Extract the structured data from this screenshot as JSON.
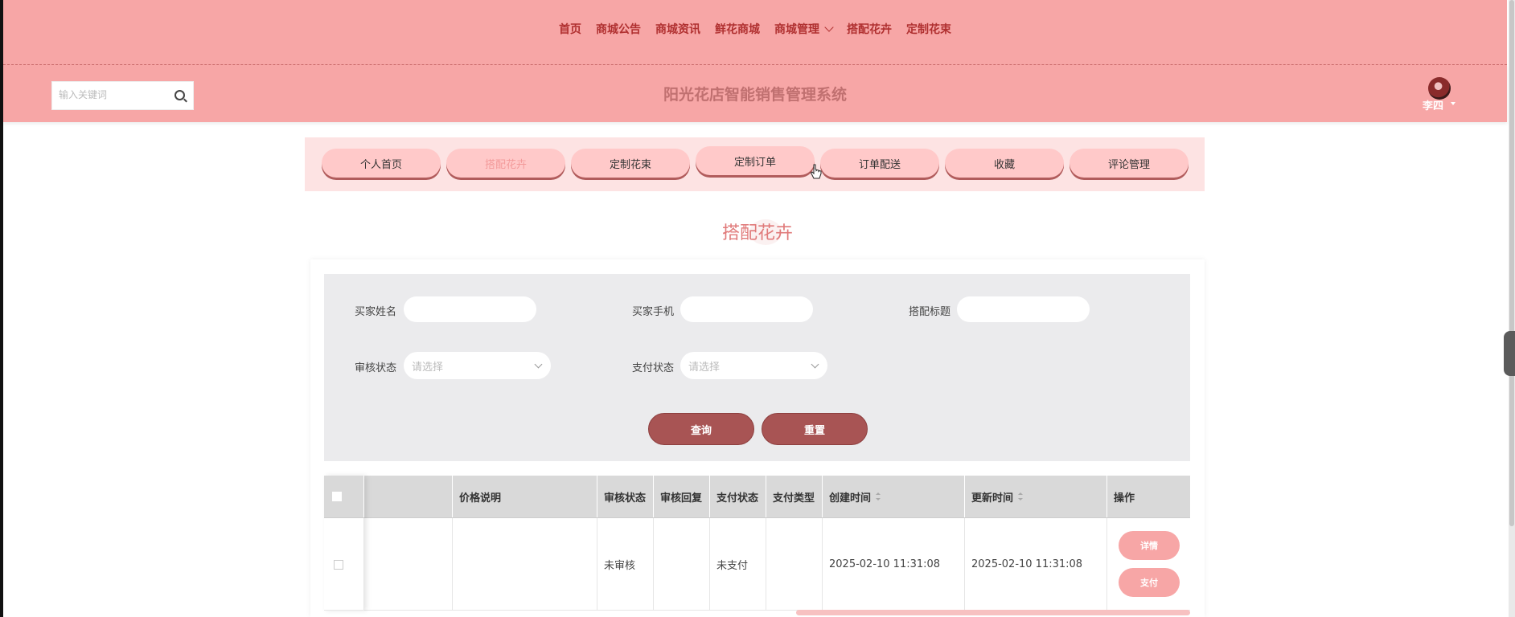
{
  "nav": {
    "items": [
      "首页",
      "商城公告",
      "商城资讯",
      "鲜花商城",
      "商城管理",
      "搭配花卉",
      "定制花束"
    ]
  },
  "header": {
    "search_placeholder": "输入关键词",
    "site_title": "阳光花店智能销售管理系统",
    "user_name": "李四"
  },
  "tabs": {
    "items": [
      "个人首页",
      "搭配花卉",
      "定制花束",
      "定制订单",
      "订单配送",
      "收藏",
      "评论管理"
    ],
    "active": "搭配花卉"
  },
  "page": {
    "title": "搭配花卉"
  },
  "filters": {
    "buyer_name_label": "买家姓名",
    "buyer_phone_label": "买家手机",
    "match_title_label": "搭配标题",
    "review_status_label": "审核状态",
    "review_status_placeholder": "请选择",
    "pay_status_label": "支付状态",
    "pay_status_placeholder": "请选择",
    "query_button": "查询",
    "reset_button": "重置"
  },
  "table": {
    "columns": [
      "价格说明",
      "审核状态",
      "审核回复",
      "支付状态",
      "支付类型",
      "创建时间",
      "更新时间",
      "操作"
    ],
    "rows": [
      {
        "price_desc": "",
        "review_status": "未审核",
        "review_reply": "",
        "pay_status": "未支付",
        "pay_type": "",
        "created": "2025-02-10 11:31:08",
        "updated": "2025-02-10 11:31:08",
        "actions": [
          "详情",
          "支付"
        ]
      }
    ]
  },
  "colors": {
    "nav_bg": "#f7a6a6",
    "nav_text": "#b03030",
    "tab_bg": "#ffc9c9",
    "button_bg": "#a85454",
    "title_pink": "#e07a7a"
  }
}
